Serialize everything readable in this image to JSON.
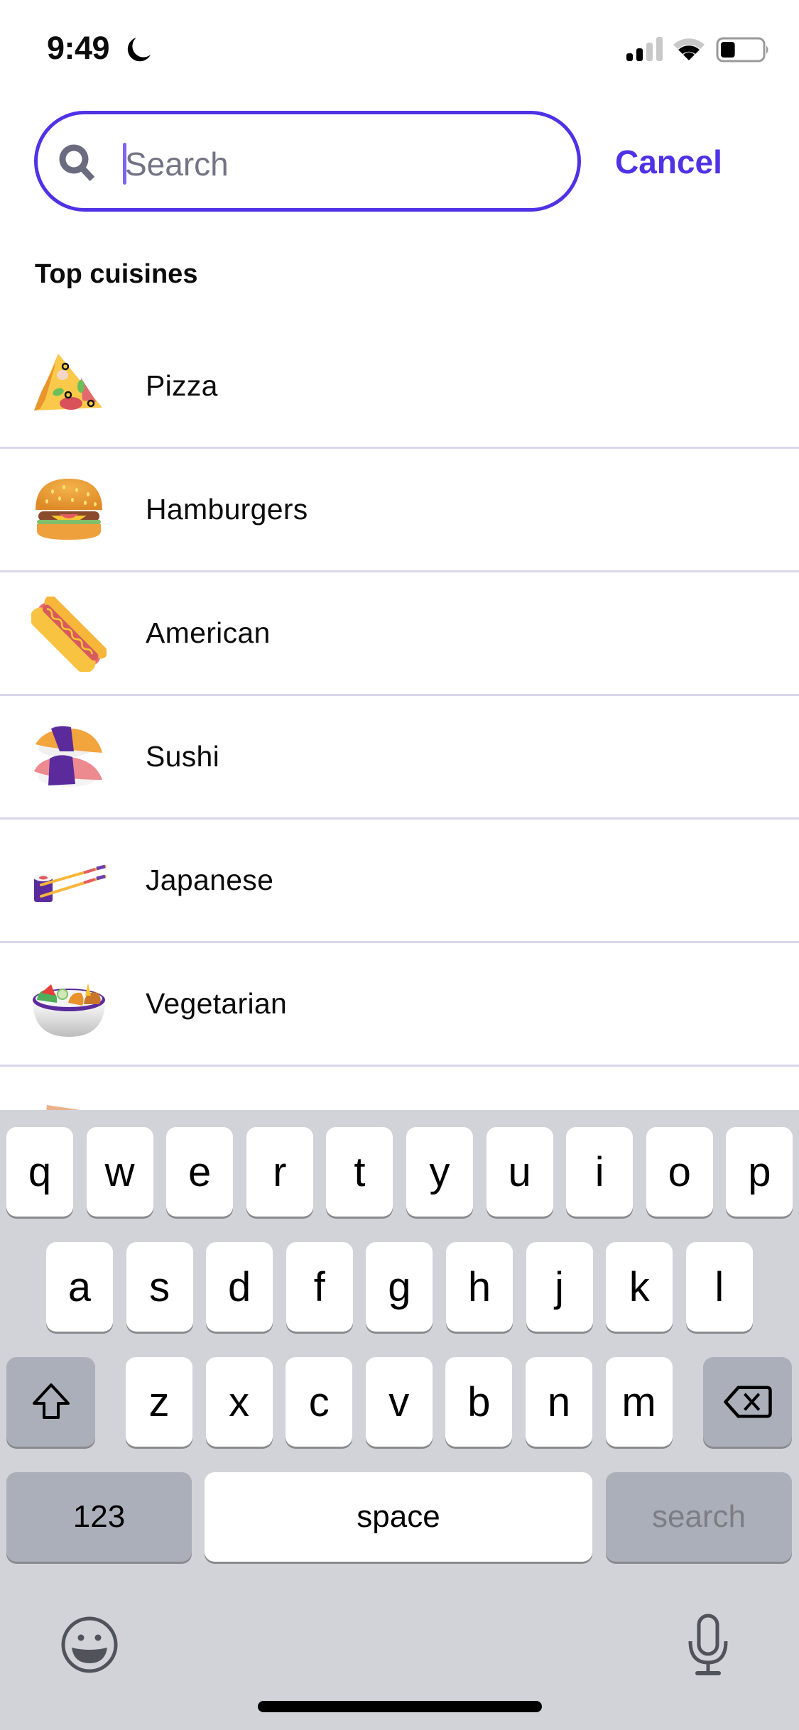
{
  "status_bar": {
    "time": "9:49",
    "focus_mode_icon": "moon-icon",
    "signal_bars_active": 2,
    "signal_bars_total": 4,
    "wifi_bars_active": 2,
    "wifi_bars_total": 3,
    "battery_level_percent": 35
  },
  "search": {
    "placeholder": "Search",
    "value": "",
    "icon": "search-icon",
    "cancel_label": "Cancel"
  },
  "colors": {
    "accent": "#5032e6",
    "divider": "#d9d7ea",
    "keyboard_bg": "#d1d3d9",
    "key_dark": "#abafb9"
  },
  "section": {
    "title": "Top cuisines"
  },
  "cuisines": [
    {
      "label": "Pizza",
      "icon": "pizza-icon"
    },
    {
      "label": "Hamburgers",
      "icon": "hamburger-icon"
    },
    {
      "label": "American",
      "icon": "hotdog-icon"
    },
    {
      "label": "Sushi",
      "icon": "sushi-icon"
    },
    {
      "label": "Japanese",
      "icon": "sushi-roll-chopsticks-icon"
    },
    {
      "label": "Vegetarian",
      "icon": "salad-bowl-icon"
    },
    {
      "label": "",
      "icon": "paper-bag-icon"
    }
  ],
  "keyboard": {
    "row1": [
      "q",
      "w",
      "e",
      "r",
      "t",
      "y",
      "u",
      "i",
      "o",
      "p"
    ],
    "row2": [
      "a",
      "s",
      "d",
      "f",
      "g",
      "h",
      "j",
      "k",
      "l"
    ],
    "row3": [
      "z",
      "x",
      "c",
      "v",
      "b",
      "n",
      "m"
    ],
    "numbers_label": "123",
    "space_label": "space",
    "return_label": "search",
    "shift_icon": "shift-icon",
    "delete_icon": "backspace-icon",
    "emoji_icon": "emoji-icon",
    "mic_icon": "microphone-icon"
  }
}
